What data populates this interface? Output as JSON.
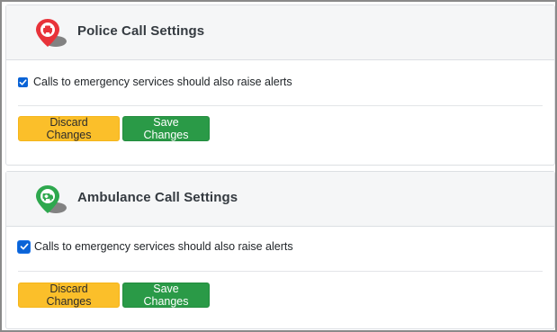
{
  "cards": [
    {
      "id": "police",
      "title": "Police Call Settings",
      "icon": "police-call-icon",
      "icon_color": "#e8333a",
      "checkbox_label": "Calls to emergency services should also raise alerts",
      "checkbox_checked": true,
      "discard_label": "Discard Changes",
      "save_label": "Save Changes"
    },
    {
      "id": "ambulance",
      "title": "Ambulance Call Settings",
      "icon": "ambulance-call-icon",
      "icon_color": "#2ea84e",
      "checkbox_label": "Calls to emergency services should also raise alerts",
      "checkbox_checked": true,
      "discard_label": "Discard Changes",
      "save_label": "Save Changes"
    }
  ],
  "colors": {
    "discard_button": "#fbbf2a",
    "save_button": "#2a9a47",
    "checkbox": "#0a63d6",
    "header_background": "#f5f6f7"
  }
}
